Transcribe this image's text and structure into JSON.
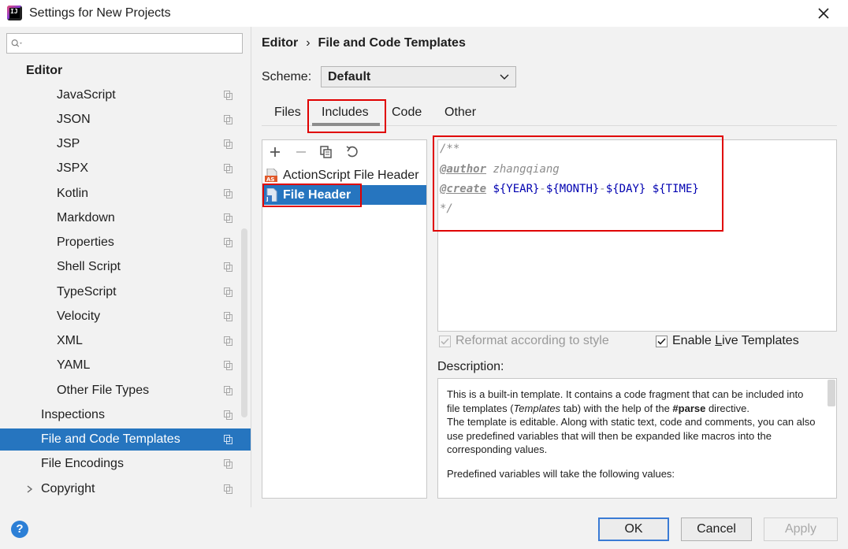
{
  "window": {
    "title": "Settings for New Projects"
  },
  "sidebar": {
    "search_placeholder": "",
    "section": "Editor",
    "items": [
      {
        "label": "JavaScript"
      },
      {
        "label": "JSON"
      },
      {
        "label": "JSP"
      },
      {
        "label": "JSPX"
      },
      {
        "label": "Kotlin"
      },
      {
        "label": "Markdown"
      },
      {
        "label": "Properties"
      },
      {
        "label": "Shell Script"
      },
      {
        "label": "TypeScript"
      },
      {
        "label": "Velocity"
      },
      {
        "label": "XML"
      },
      {
        "label": "YAML"
      },
      {
        "label": "Other File Types"
      },
      {
        "label": "Inspections"
      },
      {
        "label": "File and Code Templates"
      },
      {
        "label": "File Encodings"
      },
      {
        "label": "Copyright"
      }
    ]
  },
  "breadcrumb": {
    "parent": "Editor",
    "sep": "›",
    "current": "File and Code Templates"
  },
  "scheme": {
    "label": "Scheme:",
    "value": "Default"
  },
  "tabs": [
    {
      "label": "Files"
    },
    {
      "label": "Includes"
    },
    {
      "label": "Code"
    },
    {
      "label": "Other"
    }
  ],
  "template_list": [
    {
      "label": "ActionScript File Header",
      "icon_text": "AS"
    },
    {
      "label": "File Header",
      "icon_text": "J"
    }
  ],
  "editor": {
    "line1": "/**",
    "line2_tag": "@author",
    "line2_text": " zhangqiang",
    "line3_tag": "@create",
    "line3_sp": " ",
    "var_year": "${YEAR}",
    "dash1": "-",
    "var_month": "${MONTH}",
    "dash2": "-",
    "var_day": "${DAY}",
    "sp2": " ",
    "var_time": "${TIME}",
    "line4": "*/"
  },
  "options": {
    "reformat_label": "Reformat according to style",
    "live_templates_label": "Enable Live Templates",
    "live_templates_mnemonic": "L"
  },
  "description": {
    "label": "Description:",
    "p1_a": "This is a built-in template. It contains a code fragment that can be included into file templates (",
    "p1_em": "Templates",
    "p1_b": " tab) with the help of the ",
    "p1_strong": "#parse",
    "p1_c": " directive.",
    "p2": "The template is editable. Along with static text, code and comments, you can also use predefined variables that will then be expanded like macros into the corresponding values.",
    "p3": "Predefined variables will take the following values:"
  },
  "buttons": {
    "help": "?",
    "ok": "OK",
    "cancel": "Cancel",
    "apply": "Apply"
  },
  "colors": {
    "selection": "#2675bf",
    "highlight_box": "#e00000",
    "template_var": "#0000b0"
  }
}
